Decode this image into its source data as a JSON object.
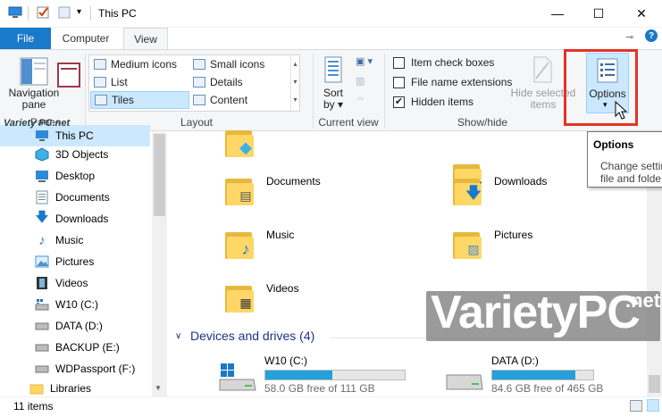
{
  "window": {
    "title": "This PC",
    "minimize": "—",
    "maximize": "☐",
    "close": "✕",
    "help": "?"
  },
  "tabs": {
    "file": "File",
    "computer": "Computer",
    "view": "View"
  },
  "ribbon": {
    "panes": {
      "navigation_line1": "Navigation",
      "navigation_line2": "pane",
      "label": "Panes"
    },
    "layout": {
      "items": [
        "Medium icons",
        "Small icons",
        "List",
        "Details",
        "Tiles",
        "Content"
      ],
      "selected": "Tiles",
      "label": "Layout"
    },
    "current_view": {
      "sort_line1": "Sort",
      "sort_line2": "by",
      "label": "Current view"
    },
    "show_hide": {
      "item_check_boxes": "Item check boxes",
      "file_name_extensions": "File name extensions",
      "hidden_items": "Hidden items",
      "hide_selected_line1": "Hide selected",
      "hide_selected_line2": "items",
      "label": "Show/hide",
      "hidden_items_checked": true
    },
    "options": {
      "label": "Options"
    }
  },
  "tooltip": {
    "title": "Options",
    "line1": "Change settin",
    "line2": "file and folde"
  },
  "nav": {
    "this_pc": "This PC",
    "items": [
      "3D Objects",
      "Desktop",
      "Documents",
      "Downloads",
      "Music",
      "Pictures",
      "Videos",
      "W10 (C:)",
      "DATA (D:)",
      "BACKUP (E:)",
      "WDPassport (F:)",
      "Libraries"
    ]
  },
  "content": {
    "folders": [
      "Documents",
      "Downloads",
      "Music",
      "Pictures",
      "Videos"
    ],
    "devices_header": "Devices and drives (4)",
    "drives": [
      {
        "name": "W10 (C:)",
        "free": "58.0 GB free of 111 GB",
        "used_fraction": 0.48
      },
      {
        "name": "DATA (D:)",
        "free": "84.6 GB free of 465 GB",
        "used_fraction": 0.82
      }
    ]
  },
  "status": {
    "count": "11 items"
  },
  "watermark": {
    "text": "VarietyPC",
    "suffix": ".net",
    "small": "Variety PC.net"
  },
  "colors": {
    "accent": "#1979ca",
    "highlight": "#e53226",
    "drive_fill": "#26a0da"
  }
}
